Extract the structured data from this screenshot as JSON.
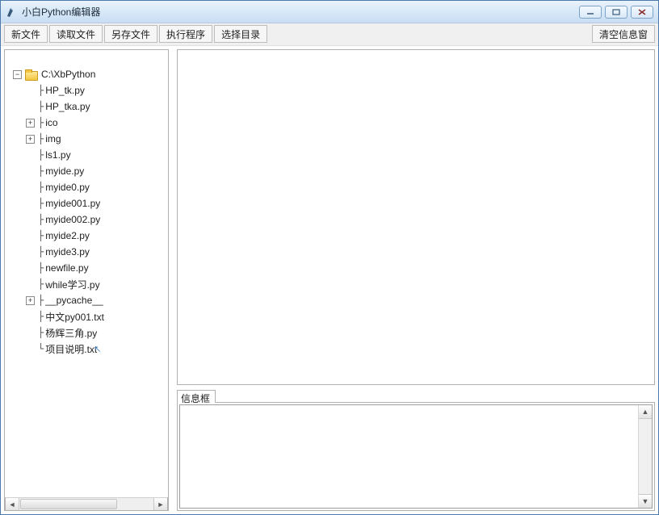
{
  "window": {
    "title": "小白Python编辑器"
  },
  "toolbar": {
    "new_file": "新文件",
    "open_file": "读取文件",
    "save_as": "另存文件",
    "run": "执行程序",
    "choose_dir": "选择目录",
    "clear_info": "清空信息窗"
  },
  "tree": {
    "root_label": "C:\\XbPython",
    "items": [
      {
        "branch": "├",
        "label": "HP_tk.py",
        "expandable": false
      },
      {
        "branch": "├",
        "label": "HP_tka.py",
        "expandable": false
      },
      {
        "branch": "├",
        "label": "ico",
        "expandable": true
      },
      {
        "branch": "├",
        "label": "img",
        "expandable": true
      },
      {
        "branch": "├",
        "label": "ls1.py",
        "expandable": false
      },
      {
        "branch": "├",
        "label": "myide.py",
        "expandable": false
      },
      {
        "branch": "├",
        "label": "myide0.py",
        "expandable": false
      },
      {
        "branch": "├",
        "label": "myide001.py",
        "expandable": false
      },
      {
        "branch": "├",
        "label": "myide002.py",
        "expandable": false
      },
      {
        "branch": "├",
        "label": "myide2.py",
        "expandable": false
      },
      {
        "branch": "├",
        "label": "myide3.py",
        "expandable": false
      },
      {
        "branch": "├",
        "label": "newfile.py",
        "expandable": false
      },
      {
        "branch": "├",
        "label": "while学习.py",
        "expandable": false
      },
      {
        "branch": "├",
        "label": "__pycache__",
        "expandable": true
      },
      {
        "branch": "├",
        "label": "中文py001.txt",
        "expandable": false
      },
      {
        "branch": "├",
        "label": "杨辉三角.py",
        "expandable": false
      },
      {
        "branch": "└",
        "label": "项目说明.txt",
        "expandable": false,
        "cursor": true
      }
    ]
  },
  "info": {
    "label": "信息框"
  }
}
